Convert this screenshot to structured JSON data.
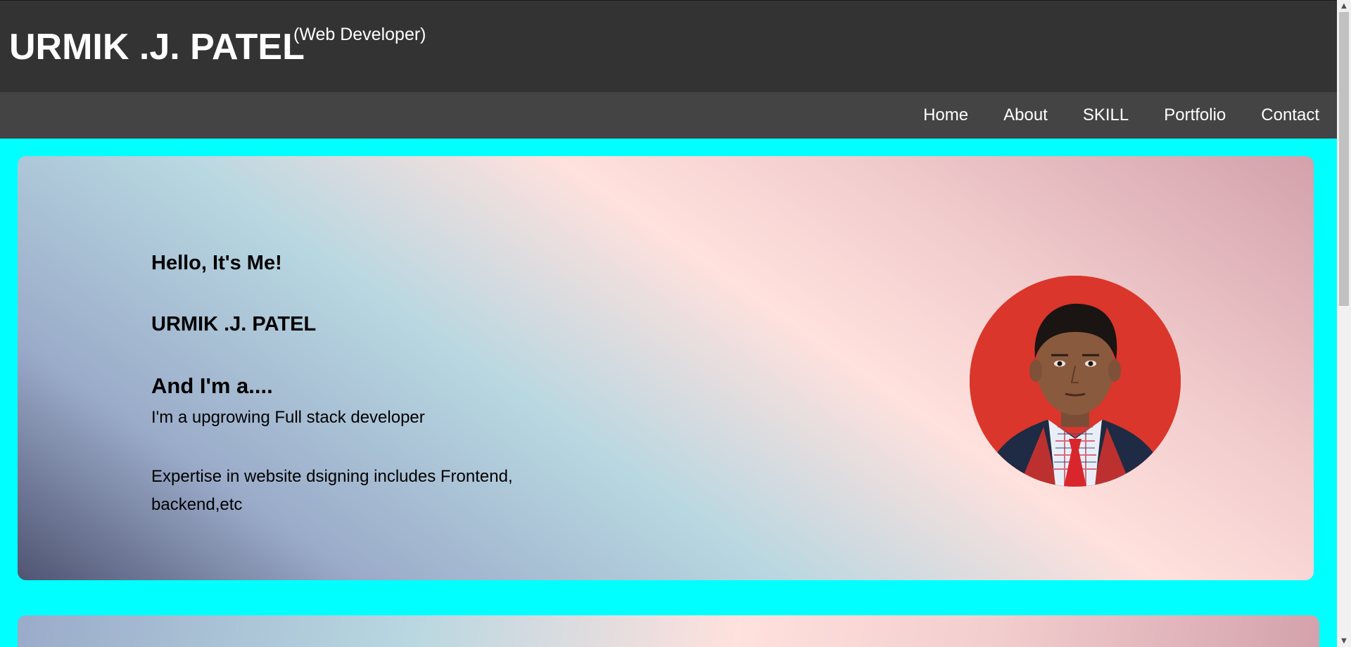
{
  "header": {
    "title": "URMIK .J. PATEL",
    "subtitle": "(Web Developer)"
  },
  "nav": {
    "items": [
      "Home",
      "About",
      "SKILL",
      "Portfolio",
      "Contact"
    ]
  },
  "hero": {
    "greeting": "Hello, It's Me!",
    "name": "URMIK .J. PATEL",
    "role_heading": "And I'm a....",
    "tagline": "I'm a upgrowing Full stack developer",
    "expertise": "Expertise in website dsigning includes Frontend, backend,etc",
    "photo": "profile-photo"
  },
  "colors": {
    "page_background": "#00ffff",
    "header_background": "#333333",
    "nav_background": "#444444"
  }
}
